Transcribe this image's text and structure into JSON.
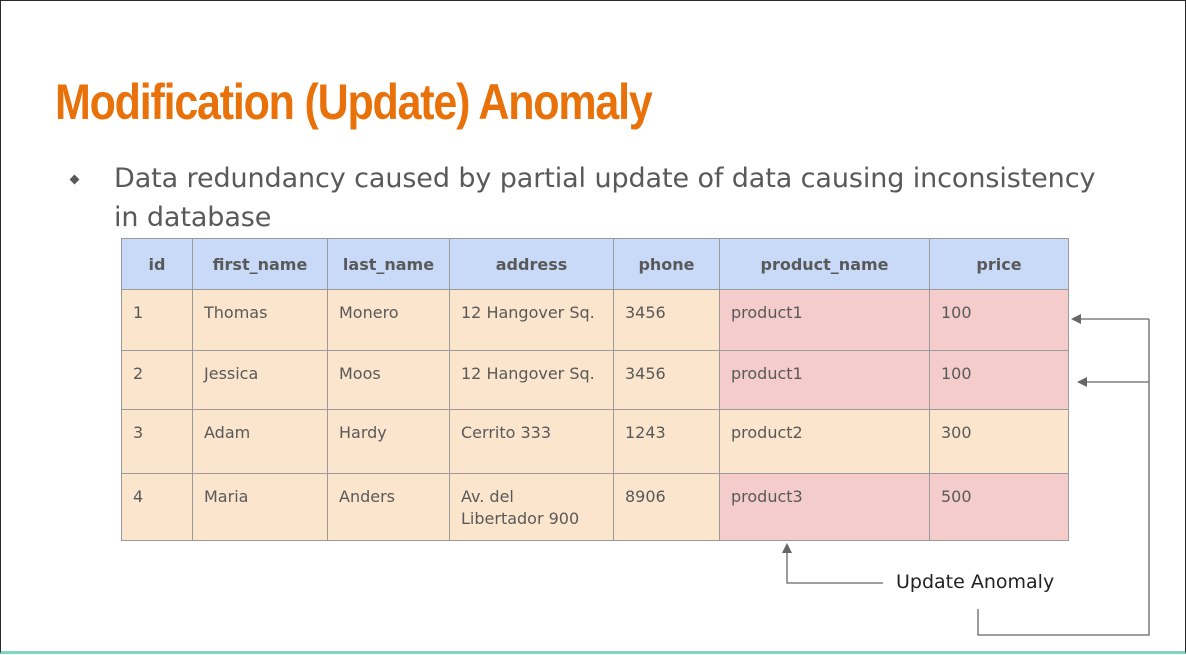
{
  "slide": {
    "title": "Modification (Update) Anomaly",
    "bullet": "Data redundancy caused by partial update of data causing inconsistency in database",
    "annotation": "Update Anomaly",
    "bullet_icon": "diamond-bullet-icon"
  },
  "table": {
    "columns": [
      "id",
      "first_name",
      "last_name",
      "address",
      "phone",
      "product_name",
      "price"
    ],
    "rows": [
      [
        "1",
        "Thomas",
        "Monero",
        "12 Hangover Sq.",
        "3456",
        "product1",
        "100"
      ],
      [
        "2",
        "Jessica",
        "Moos",
        "12 Hangover Sq.",
        "3456",
        "product1",
        "100"
      ],
      [
        "3",
        "Adam",
        "Hardy",
        "Cerrito 333",
        "1243",
        "product2",
        "300"
      ],
      [
        "4",
        "Maria",
        "Anders",
        "Av. del Libertador 900",
        "8906",
        "product3",
        "500"
      ]
    ],
    "highlighted_rows": [
      0,
      1,
      3
    ],
    "highlighted_columns": [
      5,
      6
    ]
  },
  "colors": {
    "title": "#e8710a",
    "text": "#595959",
    "bullet": "#595959",
    "header_bg": "#c9daf8",
    "cell_bg": "#fce5cd",
    "highlight_bg": "#f4cccc",
    "arrow": "#666666"
  }
}
